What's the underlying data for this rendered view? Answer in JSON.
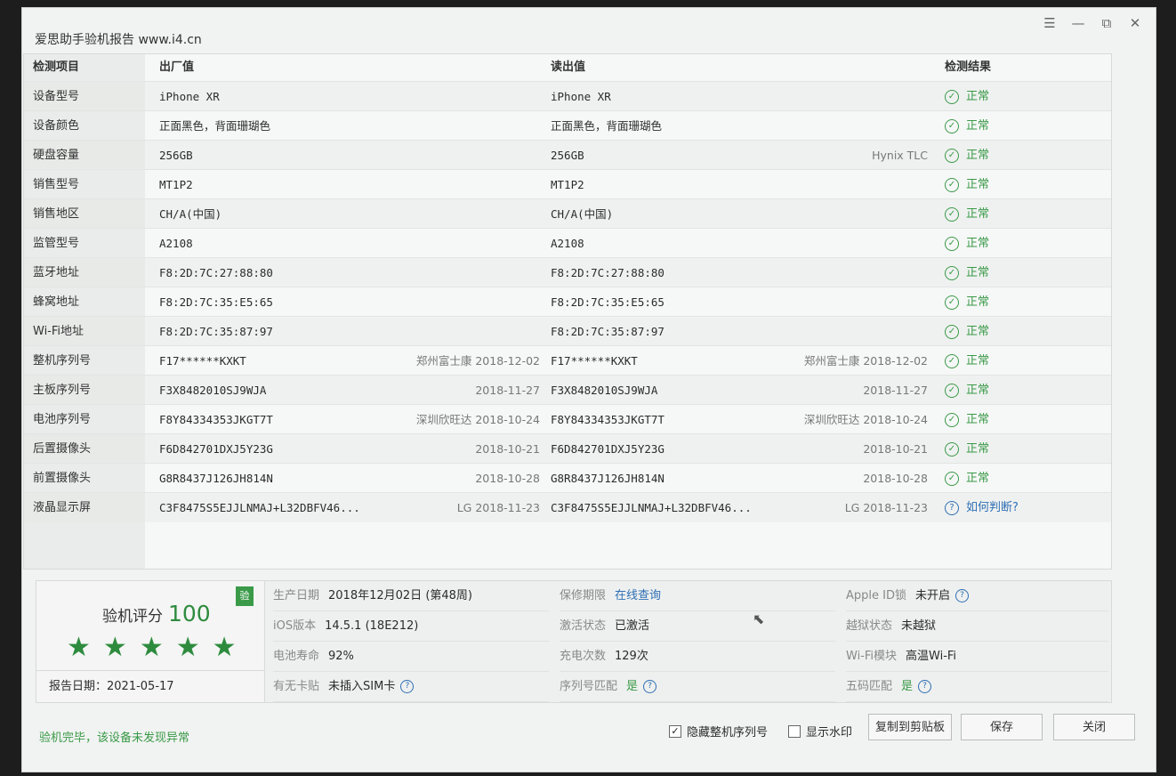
{
  "window": {
    "title": "爱思助手验机报告 www.i4.cn",
    "controls": {
      "menu": "☰",
      "minimize": "—",
      "restore": "⧉",
      "close": "✕"
    }
  },
  "table": {
    "headers": {
      "item": "检测项目",
      "factory": "出厂值",
      "read": "读出值",
      "result": "检测结果"
    },
    "rows": [
      {
        "item": "设备型号",
        "factory": "iPhone XR",
        "factory_note": "",
        "read": "iPhone XR",
        "read_note": "",
        "result": "正常",
        "result_type": "ok"
      },
      {
        "item": "设备颜色",
        "factory": "正面黑色，背面珊瑚色",
        "factory_note": "",
        "read": "正面黑色，背面珊瑚色",
        "read_note": "",
        "result": "正常",
        "result_type": "ok"
      },
      {
        "item": "硬盘容量",
        "factory": "256GB",
        "factory_note": "",
        "read": "256GB",
        "read_note": "Hynix TLC",
        "result": "正常",
        "result_type": "ok"
      },
      {
        "item": "销售型号",
        "factory": "MT1P2",
        "factory_note": "",
        "read": "MT1P2",
        "read_note": "",
        "result": "正常",
        "result_type": "ok"
      },
      {
        "item": "销售地区",
        "factory": "CH/A(中国)",
        "factory_note": "",
        "read": "CH/A(中国)",
        "read_note": "",
        "result": "正常",
        "result_type": "ok"
      },
      {
        "item": "监管型号",
        "factory": "A2108",
        "factory_note": "",
        "read": "A2108",
        "read_note": "",
        "result": "正常",
        "result_type": "ok"
      },
      {
        "item": "蓝牙地址",
        "factory": "F8:2D:7C:27:88:80",
        "factory_note": "",
        "read": "F8:2D:7C:27:88:80",
        "read_note": "",
        "result": "正常",
        "result_type": "ok"
      },
      {
        "item": "蜂窝地址",
        "factory": "F8:2D:7C:35:E5:65",
        "factory_note": "",
        "read": "F8:2D:7C:35:E5:65",
        "read_note": "",
        "result": "正常",
        "result_type": "ok"
      },
      {
        "item": "Wi-Fi地址",
        "factory": "F8:2D:7C:35:87:97",
        "factory_note": "",
        "read": "F8:2D:7C:35:87:97",
        "read_note": "",
        "result": "正常",
        "result_type": "ok"
      },
      {
        "item": "整机序列号",
        "factory": "F17******KXKT",
        "factory_note": "郑州富士康 2018-12-02",
        "read": "F17******KXKT",
        "read_note": "郑州富士康 2018-12-02",
        "result": "正常",
        "result_type": "ok"
      },
      {
        "item": "主板序列号",
        "factory": "F3X8482010SJ9WJA",
        "factory_note": "2018-11-27",
        "read": "F3X8482010SJ9WJA",
        "read_note": "2018-11-27",
        "result": "正常",
        "result_type": "ok"
      },
      {
        "item": "电池序列号",
        "factory": "F8Y84334353JKGT7T",
        "factory_note": "深圳欣旺达 2018-10-24",
        "read": "F8Y84334353JKGT7T",
        "read_note": "深圳欣旺达 2018-10-24",
        "result": "正常",
        "result_type": "ok"
      },
      {
        "item": "后置摄像头",
        "factory": "F6D842701DXJ5Y23G",
        "factory_note": "2018-10-21",
        "read": "F6D842701DXJ5Y23G",
        "read_note": "2018-10-21",
        "result": "正常",
        "result_type": "ok"
      },
      {
        "item": "前置摄像头",
        "factory": "G8R8437J126JH814N",
        "factory_note": "2018-10-28",
        "read": "G8R8437J126JH814N",
        "read_note": "2018-10-28",
        "result": "正常",
        "result_type": "ok"
      },
      {
        "item": "液晶显示屏",
        "factory": "C3F8475S5EJJLNMAJ+L32DBFV46...",
        "factory_note": "LG 2018-11-23",
        "read": "C3F8475S5EJJLNMAJ+L32DBFV46...",
        "read_note": "LG 2018-11-23",
        "result": "如何判断?",
        "result_type": "question"
      }
    ]
  },
  "summary": {
    "score_label": "验机评分",
    "score": "100",
    "badge": "验",
    "rating_stars": 5,
    "star_glyph": "★",
    "report_date": "报告日期：2021-05-17",
    "info": [
      [
        {
          "label": "生产日期",
          "value": "2018年12月02日 (第48周)",
          "style": "normal"
        },
        {
          "label": "保修期限",
          "value": "在线查询",
          "style": "link"
        },
        {
          "label": "Apple ID锁",
          "value": "未开启",
          "style": "normal",
          "help": true
        }
      ],
      [
        {
          "label": "iOS版本",
          "value": "14.5.1 (18E212)",
          "style": "normal"
        },
        {
          "label": "激活状态",
          "value": "已激活",
          "style": "normal"
        },
        {
          "label": "越狱状态",
          "value": "未越狱",
          "style": "normal"
        }
      ],
      [
        {
          "label": "电池寿命",
          "value": "92%",
          "style": "normal"
        },
        {
          "label": "充电次数",
          "value": "129次",
          "style": "normal"
        },
        {
          "label": "Wi-Fi模块",
          "value": "高温Wi-Fi",
          "style": "normal"
        }
      ],
      [
        {
          "label": "有无卡贴",
          "value": "未插入SIM卡",
          "style": "normal",
          "help": true
        },
        {
          "label": "序列号匹配",
          "value": "是",
          "style": "green",
          "help": true
        },
        {
          "label": "五码匹配",
          "value": "是",
          "style": "green",
          "help": true
        }
      ]
    ]
  },
  "footer": {
    "status": "验机完毕，该设备未发现异常",
    "hide_serial_label": "隐藏整机序列号",
    "hide_serial_checked": true,
    "watermark_label": "显示水印",
    "watermark_checked": false,
    "copy_button": "复制到剪贴板",
    "save_button": "保存",
    "close_button": "关闭"
  },
  "colors": {
    "accent_green": "#3a9a48",
    "link_blue": "#2f6fb5"
  }
}
